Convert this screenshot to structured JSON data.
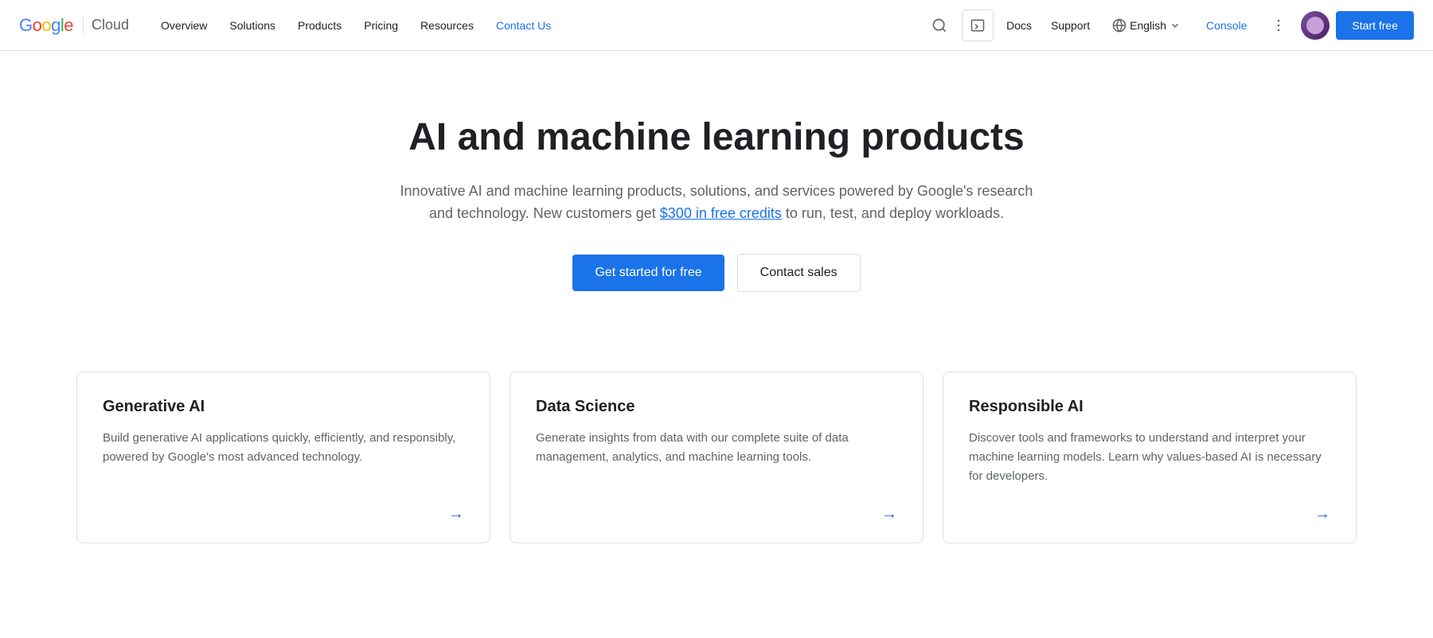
{
  "navbar": {
    "logo_google": "Google",
    "logo_cloud": "Cloud",
    "links": [
      {
        "label": "Overview",
        "id": "overview",
        "active": false
      },
      {
        "label": "Solutions",
        "id": "solutions",
        "active": false
      },
      {
        "label": "Products",
        "id": "products",
        "active": false
      },
      {
        "label": "Pricing",
        "id": "pricing",
        "active": false
      },
      {
        "label": "Resources",
        "id": "resources",
        "active": false
      },
      {
        "label": "Contact Us",
        "id": "contact",
        "active": true
      }
    ],
    "docs_label": "Docs",
    "support_label": "Support",
    "language_label": "English",
    "console_label": "Console",
    "start_free_label": "Start free",
    "search_title": "Search",
    "terminal_title": "Cloud Shell",
    "more_title": "More options"
  },
  "hero": {
    "title": "AI and machine learning products",
    "description_before": "Innovative AI and machine learning products, solutions, and services powered by Google's research and technology. New customers get ",
    "credits_link": "$300 in free credits",
    "description_after": " to run, test, and deploy workloads.",
    "cta_primary": "Get started for free",
    "cta_secondary": "Contact sales"
  },
  "cards": [
    {
      "id": "generative-ai",
      "title": "Generative AI",
      "description": "Build generative AI applications quickly, efficiently, and responsibly, powered by Google's most advanced technology.",
      "arrow": "→"
    },
    {
      "id": "data-science",
      "title": "Data Science",
      "description": "Generate insights from data with our complete suite of data management, analytics, and machine learning tools.",
      "arrow": "→"
    },
    {
      "id": "responsible-ai",
      "title": "Responsible AI",
      "description": "Discover tools and frameworks to understand and interpret your machine learning models. Learn why values-based AI is necessary for developers.",
      "arrow": "→"
    }
  ],
  "colors": {
    "primary_blue": "#1a73e8",
    "text_dark": "#202124",
    "text_gray": "#5f6368",
    "border": "#e0e0e0",
    "bg_white": "#ffffff"
  }
}
